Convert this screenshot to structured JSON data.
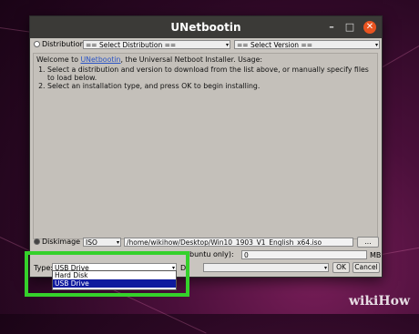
{
  "window": {
    "title": "UNetbootin"
  },
  "top": {
    "distribution_label": "Distribution",
    "distribution_value": "== Select Distribution ==",
    "version_value": "== Select Version =="
  },
  "info": {
    "welcome_prefix": "Welcome to ",
    "welcome_link": "UNetbootin",
    "welcome_suffix": ", the Universal Netboot Installer. Usage:",
    "steps": [
      "Select a distribution and version to download from the list above, or manually specify files to load below.",
      "Select an installation type, and press OK to begin installing."
    ]
  },
  "diskimage": {
    "label": "Diskimage",
    "format": "ISO",
    "path": "/home/wikihow/Desktop/Win10_1903_V1_English_x64.iso",
    "browse_label": "..."
  },
  "space": {
    "label_partial": "buntu only):",
    "value": "0",
    "unit": "MB"
  },
  "bottom": {
    "type_label": "Type:",
    "type_value": "USB Drive",
    "drive_label": "Dr",
    "ok_label": "OK",
    "cancel_label": "Cancel"
  },
  "type_options": [
    "Hard Disk",
    "USB Drive"
  ],
  "watermark": "wikiHow"
}
